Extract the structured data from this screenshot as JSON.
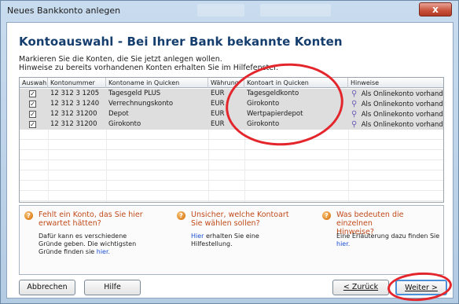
{
  "window": {
    "title": "Neues Bankkonto anlegen",
    "close_label": "x"
  },
  "page": {
    "heading": "Kontoauswahl - Bei Ihrer Bank bekannte Konten",
    "subtext_line1": "Markieren Sie die Konten, die Sie jetzt anlegen wollen.",
    "subtext_line2": "Hinweise zu bereits vorhandenen Konten erhalten Sie im Hilfefenster."
  },
  "table": {
    "headers": [
      "Auswahl",
      "Kontonummer",
      "Kontoname in Quicken",
      "Währung",
      "Kontoart in Quicken",
      "Hinweise"
    ],
    "rows": [
      {
        "checked": true,
        "nummer": "12 312 3 1205",
        "name": "Tagesgeld PLUS",
        "waehrung": "EUR",
        "kontoart": "Tagesgeldkonto",
        "hinweis": "Als Onlinekonto vorhanden"
      },
      {
        "checked": true,
        "nummer": "12 312 3 1240",
        "name": "Verrechnungskonto",
        "waehrung": "EUR",
        "kontoart": "Girokonto",
        "hinweis": "Als Onlinekonto vorhanden"
      },
      {
        "checked": true,
        "nummer": "12 312 31200",
        "name": "Depot",
        "waehrung": "EUR",
        "kontoart": "Wertpapierdepot",
        "hinweis": "Als Onlinekonto vorhanden"
      },
      {
        "checked": true,
        "nummer": "12 312 31200",
        "name": "Girokonto",
        "waehrung": "EUR",
        "kontoart": "Girokonto",
        "hinweis": "Als Onlinekonto vorhanden"
      }
    ],
    "check_glyph": "✓",
    "link_icon": "chain-link-icon"
  },
  "hints": [
    {
      "icon": "question-icon",
      "title1": "Fehlt ein Konto, das Sie hier",
      "title2": "erwartet hätten?",
      "body1": "Dafür kann es verschiedene",
      "body2": "Gründe geben. Die wichtigsten",
      "body3_pre": "Gründe finden sie ",
      "body3_link": "hier."
    },
    {
      "icon": "question-icon",
      "title1": "Unsicher, welche Kontoart",
      "title2": "Sie wählen sollen?",
      "body1_link": "Hier",
      "body1_post": " erhalten Sie eine",
      "body2": "Hilfestellung."
    },
    {
      "icon": "question-icon",
      "title1": "Was bedeuten die einzelnen",
      "title2": "Hinweise?",
      "body1": "Eine Erläuterung dazu finden Sie",
      "body2_link": "hier."
    }
  ],
  "buttons": {
    "abbrechen": "Abbrechen",
    "hilfe": "Hilfe",
    "zurueck": "< Zurück",
    "weiter": "Weiter >"
  },
  "colors": {
    "heading": "#153e6e",
    "hint_title": "#c04a1a",
    "link": "#1c4fd6",
    "annotation": "#e3262c"
  }
}
